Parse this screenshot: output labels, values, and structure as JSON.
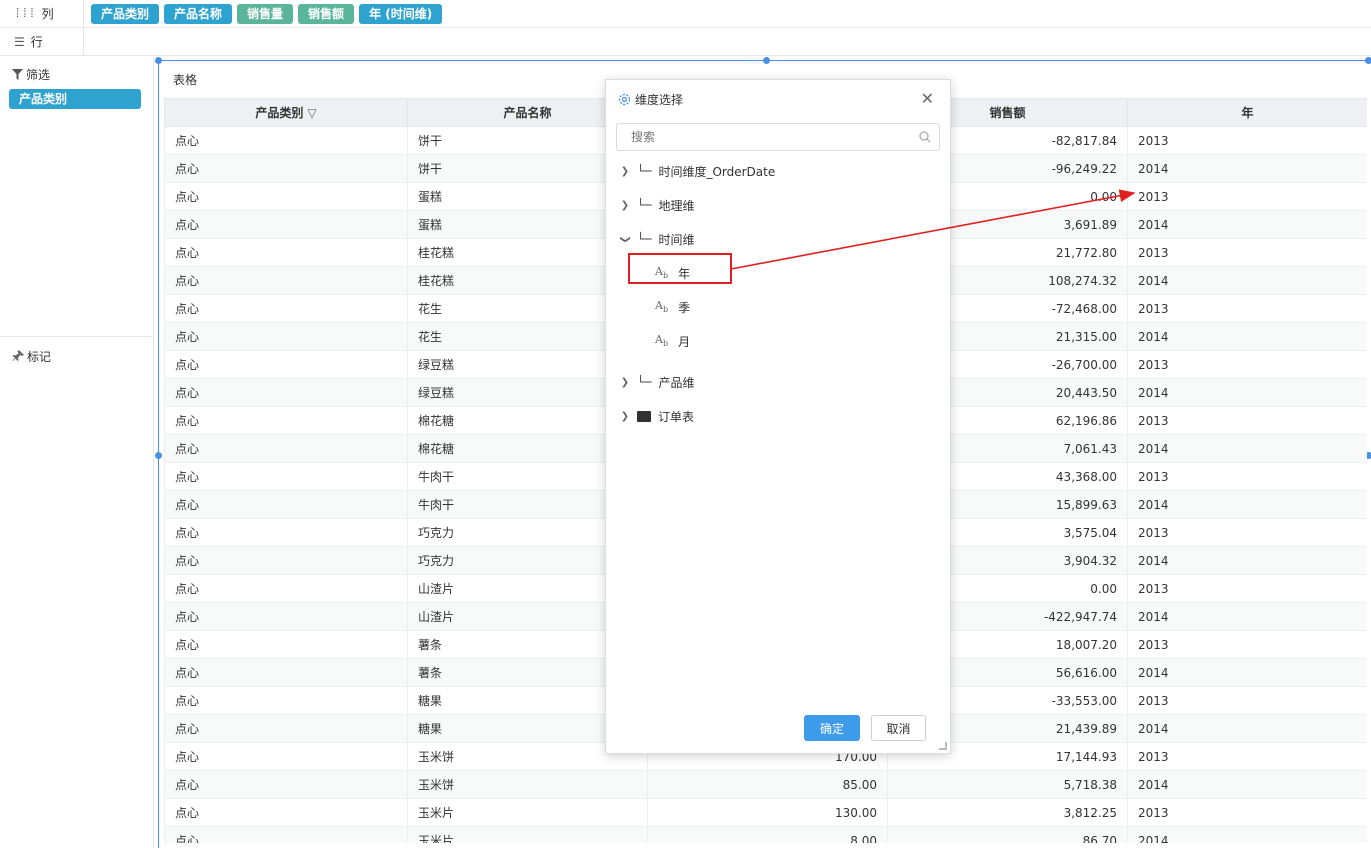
{
  "columns_shelf": {
    "label": "列",
    "icon": "columns-icon",
    "pills": [
      {
        "label": "产品类别",
        "kind": "dimension"
      },
      {
        "label": "产品名称",
        "kind": "dimension"
      },
      {
        "label": "销售量",
        "kind": "measure"
      },
      {
        "label": "销售额",
        "kind": "measure"
      },
      {
        "label": "年 (时间维)",
        "kind": "dimension"
      }
    ]
  },
  "rows_shelf": {
    "label": "行",
    "icon": "list-icon"
  },
  "filter": {
    "title": "筛选",
    "icon": "funnel-icon",
    "pill": "产品类别"
  },
  "marks": {
    "title": "标记",
    "icon": "pin-icon"
  },
  "table": {
    "title": "表格",
    "headers": [
      "产品类别",
      "产品名称",
      "",
      "销售额",
      "年"
    ],
    "rows": [
      [
        "点心",
        "饼干",
        "",
        "-82,817.84",
        "2013"
      ],
      [
        "点心",
        "饼干",
        "",
        "-96,249.22",
        "2014"
      ],
      [
        "点心",
        "蛋糕",
        "",
        "0.00",
        "2013"
      ],
      [
        "点心",
        "蛋糕",
        "",
        "3,691.89",
        "2014"
      ],
      [
        "点心",
        "桂花糕",
        "",
        "21,772.80",
        "2013"
      ],
      [
        "点心",
        "桂花糕",
        "",
        "108,274.32",
        "2014"
      ],
      [
        "点心",
        "花生",
        "",
        "-72,468.00",
        "2013"
      ],
      [
        "点心",
        "花生",
        "",
        "21,315.00",
        "2014"
      ],
      [
        "点心",
        "绿豆糕",
        "",
        "-26,700.00",
        "2013"
      ],
      [
        "点心",
        "绿豆糕",
        "",
        "20,443.50",
        "2014"
      ],
      [
        "点心",
        "棉花糖",
        "",
        "62,196.86",
        "2013"
      ],
      [
        "点心",
        "棉花糖",
        "",
        "7,061.43",
        "2014"
      ],
      [
        "点心",
        "牛肉干",
        "",
        "43,368.00",
        "2013"
      ],
      [
        "点心",
        "牛肉干",
        "",
        "15,899.63",
        "2014"
      ],
      [
        "点心",
        "巧克力",
        "",
        "3,575.04",
        "2013"
      ],
      [
        "点心",
        "巧克力",
        "",
        "3,904.32",
        "2014"
      ],
      [
        "点心",
        "山渣片",
        "",
        "0.00",
        "2013"
      ],
      [
        "点心",
        "山渣片",
        "",
        "-422,947.74",
        "2014"
      ],
      [
        "点心",
        "薯条",
        "",
        "18,007.20",
        "2013"
      ],
      [
        "点心",
        "薯条",
        "",
        "56,616.00",
        "2014"
      ],
      [
        "点心",
        "糖果",
        "",
        "-33,553.00",
        "2013"
      ],
      [
        "点心",
        "糖果",
        "",
        "21,439.89",
        "2014"
      ],
      [
        "点心",
        "玉米饼",
        "170.00",
        "17,144.93",
        "2013"
      ],
      [
        "点心",
        "玉米饼",
        "85.00",
        "5,718.38",
        "2014"
      ],
      [
        "点心",
        "玉米片",
        "130.00",
        "3,812.25",
        "2013"
      ],
      [
        "点心",
        "玉米片",
        "8.00",
        "86.70",
        "2014"
      ]
    ]
  },
  "dialog": {
    "title": "维度选择",
    "search_placeholder": "搜索",
    "tree": [
      {
        "label": "时间维度_OrderDate",
        "type": "hierarchy",
        "expanded": false
      },
      {
        "label": "地理维",
        "type": "hierarchy",
        "expanded": false
      },
      {
        "label": "时间维",
        "type": "hierarchy",
        "expanded": true,
        "children": [
          "年",
          "季",
          "月"
        ]
      },
      {
        "label": "产品维",
        "type": "hierarchy",
        "expanded": false
      },
      {
        "label": "订单表",
        "type": "folder",
        "expanded": false
      }
    ],
    "ok_label": "确定",
    "cancel_label": "取消"
  },
  "annotation": {
    "color": "#e02020"
  },
  "colors": {
    "dimension_pill": "#2fa3cf",
    "measure_pill": "#5bb59a",
    "primary_button": "#3d9be9",
    "selection": "#4a90e2"
  }
}
